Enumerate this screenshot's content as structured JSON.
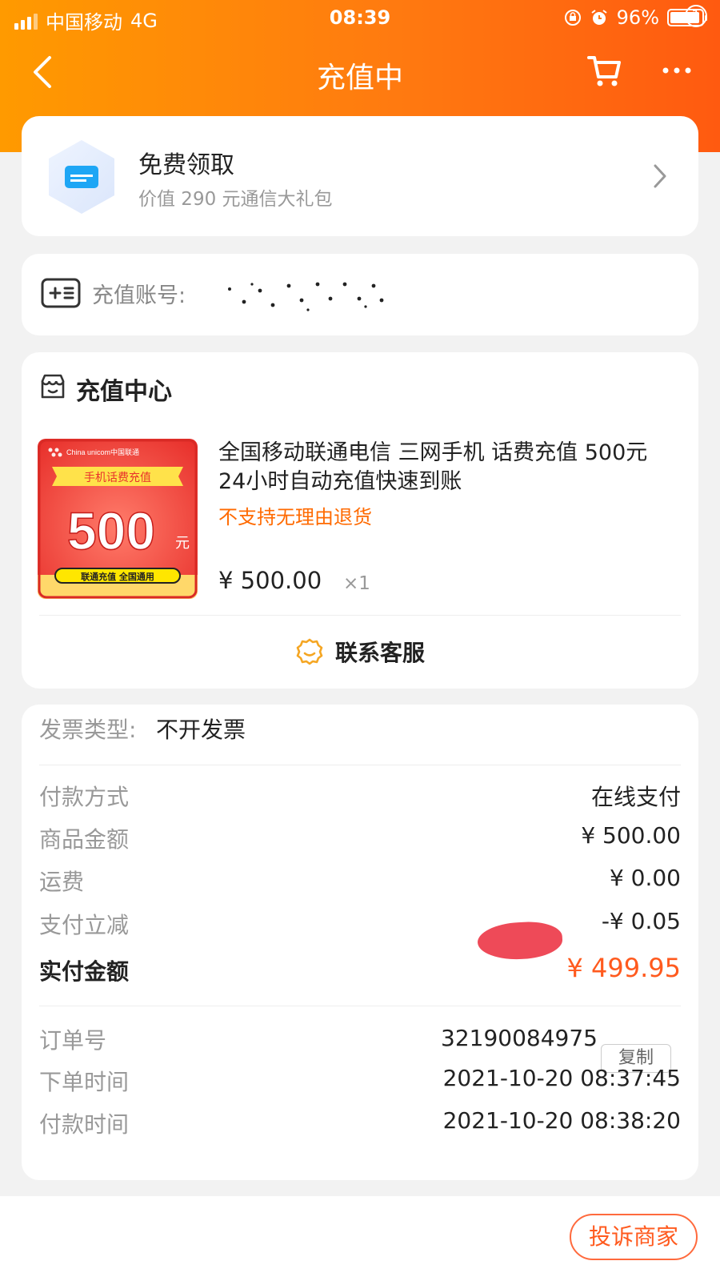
{
  "status_bar": {
    "carrier": "中国移动",
    "network": "4G",
    "time": "08:39",
    "battery": "96%"
  },
  "nav": {
    "title": "充值中",
    "badge_count": "1"
  },
  "gift": {
    "title": "免费领取",
    "subtitle": "价值 290 元通信大礼包"
  },
  "account": {
    "label": "充值账号:"
  },
  "store": {
    "name": "充值中心",
    "product": {
      "title": "全国移动联通电信 三网手机 话费充值 500元 24小时自动充值快速到账",
      "note": "不支持无理由退货",
      "price": "¥ 500.00",
      "qty": "×1",
      "image": {
        "brand": "China unicom中国联通",
        "banner": "手机话费充值",
        "amount": "500",
        "unit": "元",
        "footer": "联通充值  全国通用"
      }
    },
    "service_label": "联系客服"
  },
  "info": {
    "invoice_label": "发票类型:",
    "invoice_value": "不开发票",
    "payment_method": {
      "label": "付款方式",
      "value": "在线支付"
    },
    "goods_amount": {
      "label": "商品金额",
      "value": "¥ 500.00"
    },
    "shipping": {
      "label": "运费",
      "value": "¥ 0.00"
    },
    "discount": {
      "label": "支付立减",
      "value": "-¥ 0.05"
    },
    "paid": {
      "label": "实付金额",
      "value": "¥ 499.95"
    },
    "order_no": {
      "label": "订单号",
      "value": "32190084975",
      "copy_label": "复制"
    },
    "order_time": {
      "label": "下单时间",
      "value": "2021-10-20 08:37:45"
    },
    "pay_time": {
      "label": "付款时间",
      "value": "2021-10-20 08:38:20"
    }
  },
  "bottom": {
    "complain_label": "投诉商家"
  },
  "colors": {
    "accent": "#ff6a00",
    "header_start": "#ff9a00",
    "header_end": "#ff5a10",
    "price_red": "#ff5a1e"
  }
}
